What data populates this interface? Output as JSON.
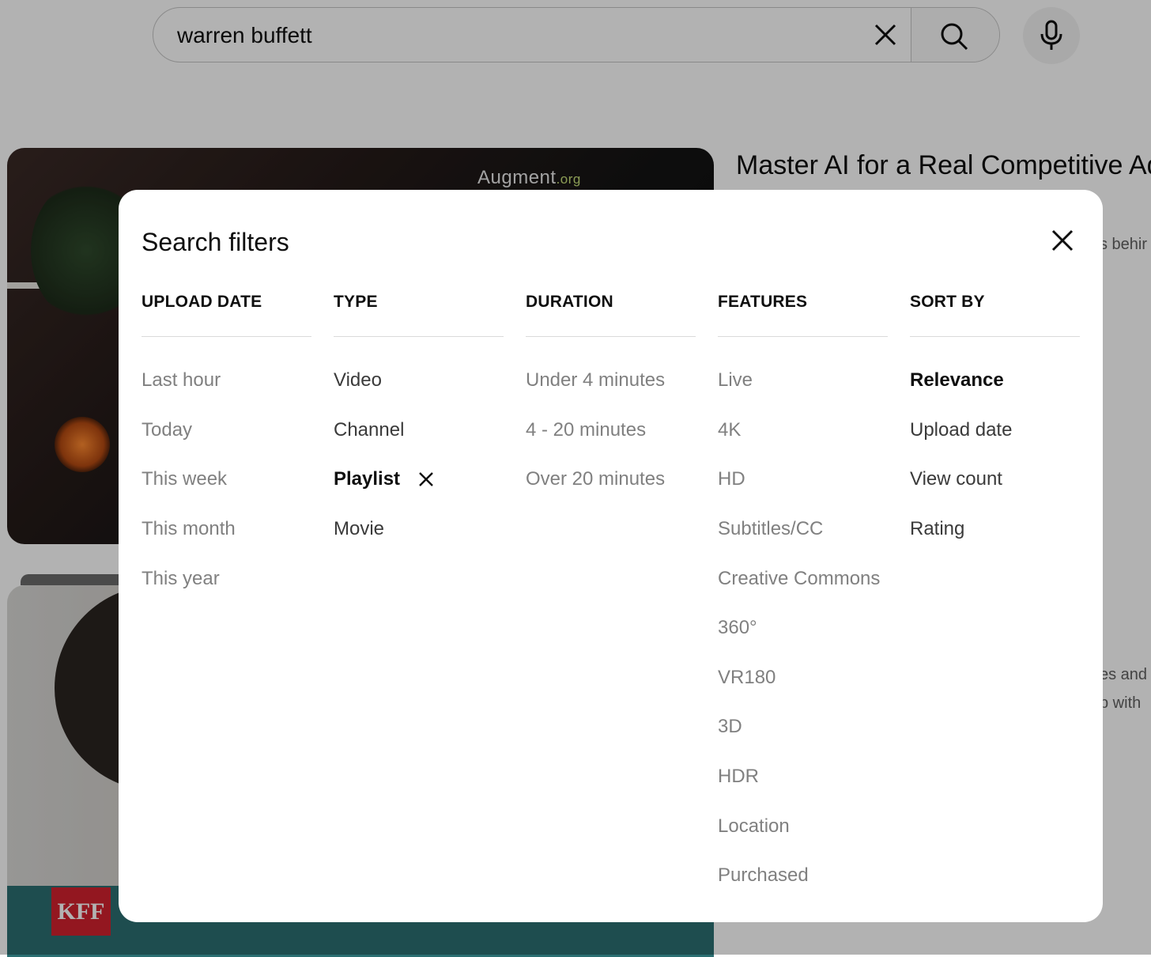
{
  "search": {
    "query": "warren buffett"
  },
  "background": {
    "video_title": "Master AI for a Real Competitive Adv",
    "thumbnail_brand": "Augment",
    "thumbnail_brand_suffix": ".org",
    "snippet_1": "s behir",
    "snippet_2": "es and",
    "snippet_3": "p with",
    "channel_logo": "KFF"
  },
  "dialog": {
    "title": "Search filters",
    "columns": [
      {
        "header": "UPLOAD DATE",
        "options": [
          {
            "label": "Last hour",
            "state": "disabled"
          },
          {
            "label": "Today",
            "state": "disabled"
          },
          {
            "label": "This week",
            "state": "disabled"
          },
          {
            "label": "This month",
            "state": "disabled"
          },
          {
            "label": "This year",
            "state": "disabled"
          }
        ]
      },
      {
        "header": "TYPE",
        "options": [
          {
            "label": "Video",
            "state": "enabled"
          },
          {
            "label": "Channel",
            "state": "enabled"
          },
          {
            "label": "Playlist",
            "state": "selected"
          },
          {
            "label": "Movie",
            "state": "enabled"
          }
        ]
      },
      {
        "header": "DURATION",
        "options": [
          {
            "label": "Under 4 minutes",
            "state": "disabled"
          },
          {
            "label": "4 - 20 minutes",
            "state": "disabled"
          },
          {
            "label": "Over 20 minutes",
            "state": "disabled"
          }
        ]
      },
      {
        "header": "FEATURES",
        "options": [
          {
            "label": "Live",
            "state": "disabled"
          },
          {
            "label": "4K",
            "state": "disabled"
          },
          {
            "label": "HD",
            "state": "disabled"
          },
          {
            "label": "Subtitles/CC",
            "state": "disabled"
          },
          {
            "label": "Creative Commons",
            "state": "disabled"
          },
          {
            "label": "360°",
            "state": "disabled"
          },
          {
            "label": "VR180",
            "state": "disabled"
          },
          {
            "label": "3D",
            "state": "disabled"
          },
          {
            "label": "HDR",
            "state": "disabled"
          },
          {
            "label": "Location",
            "state": "disabled"
          },
          {
            "label": "Purchased",
            "state": "disabled"
          }
        ]
      },
      {
        "header": "SORT BY",
        "options": [
          {
            "label": "Relevance",
            "state": "selected"
          },
          {
            "label": "Upload date",
            "state": "enabled"
          },
          {
            "label": "View count",
            "state": "enabled"
          },
          {
            "label": "Rating",
            "state": "enabled"
          }
        ]
      }
    ]
  },
  "colors": {
    "scrim": "#000000",
    "text_primary": "#0f0f0f",
    "text_disabled": "#808080",
    "kff_red": "#d3212f"
  },
  "icons": {
    "clear": "close-icon",
    "search": "search-icon",
    "mic": "microphone-icon",
    "dialog_close": "close-icon",
    "remove_filter": "close-icon"
  }
}
